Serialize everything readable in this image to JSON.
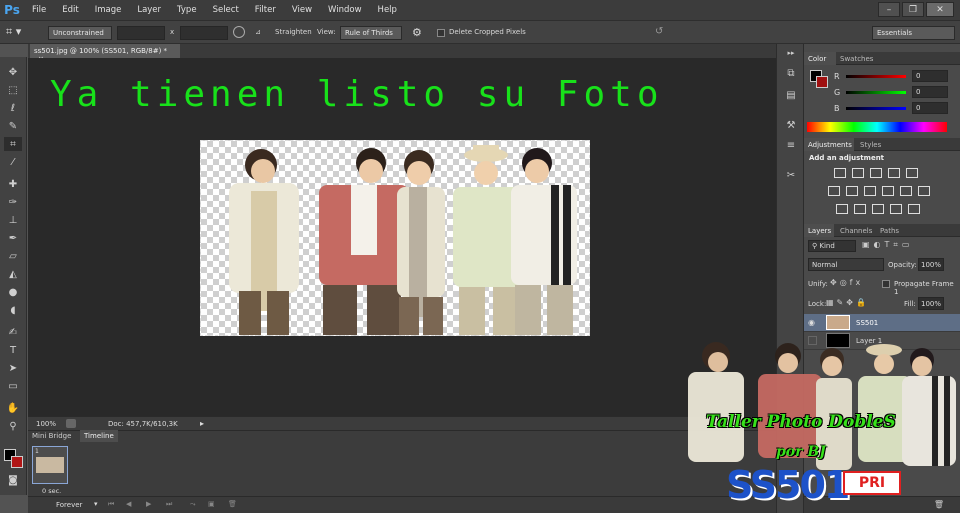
{
  "app": {
    "logo": "Ps"
  },
  "menu": [
    "File",
    "Edit",
    "Image",
    "Layer",
    "Type",
    "Select",
    "Filter",
    "View",
    "Window",
    "Help"
  ],
  "window_controls": {
    "minimize": "–",
    "restore": "❐",
    "close": "✕"
  },
  "options_bar": {
    "ratio": "Unconstrained",
    "times": "x",
    "straighten": "Straighten",
    "view_label": "View:",
    "view_value": "Rule of Thirds",
    "delete_cropped": "Delete Cropped Pixels",
    "workspace": "Essentials"
  },
  "document": {
    "tab_title": "ss501.jpg @ 100% (SS501, RGB/8#) *",
    "close": "×"
  },
  "canvas": {
    "headline": "Ya tienen listo su Foto"
  },
  "status": {
    "zoom": "100%",
    "doc": "Doc: 457,7K/610,3K"
  },
  "timeline": {
    "tabs": [
      "Mini Bridge",
      "Timeline"
    ],
    "frame_number": "1",
    "frame_delay": "0 sec.",
    "loop": "Forever"
  },
  "panels": {
    "color": {
      "tabs": [
        "Color",
        "Swatches"
      ],
      "channels": [
        {
          "label": "R",
          "value": "0"
        },
        {
          "label": "G",
          "value": "0"
        },
        {
          "label": "B",
          "value": "0"
        }
      ]
    },
    "adjustments": {
      "tabs": [
        "Adjustments",
        "Styles"
      ],
      "heading": "Add an adjustment"
    },
    "layers": {
      "tabs": [
        "Layers",
        "Channels",
        "Paths"
      ],
      "kind": "Kind",
      "blend_mode": "Normal",
      "opacity_label": "Opacity:",
      "opacity_value": "100%",
      "unify_label": "Unify:",
      "propagate": "Propagate Frame 1",
      "lock_label": "Lock:",
      "fill_label": "Fill:",
      "fill_value": "100%",
      "items": [
        {
          "name": "SS501"
        },
        {
          "name": "Layer 1"
        }
      ]
    }
  },
  "watermark": {
    "title": "Taller Photo DobleS",
    "subtitle": "por BJ",
    "logo": "SS501",
    "badge": "PRI"
  },
  "colors": {
    "headline": "#18e11a",
    "watermark_green": "#37e11a",
    "logo_blue": "#1d52c9",
    "badge_red": "#e02020"
  }
}
